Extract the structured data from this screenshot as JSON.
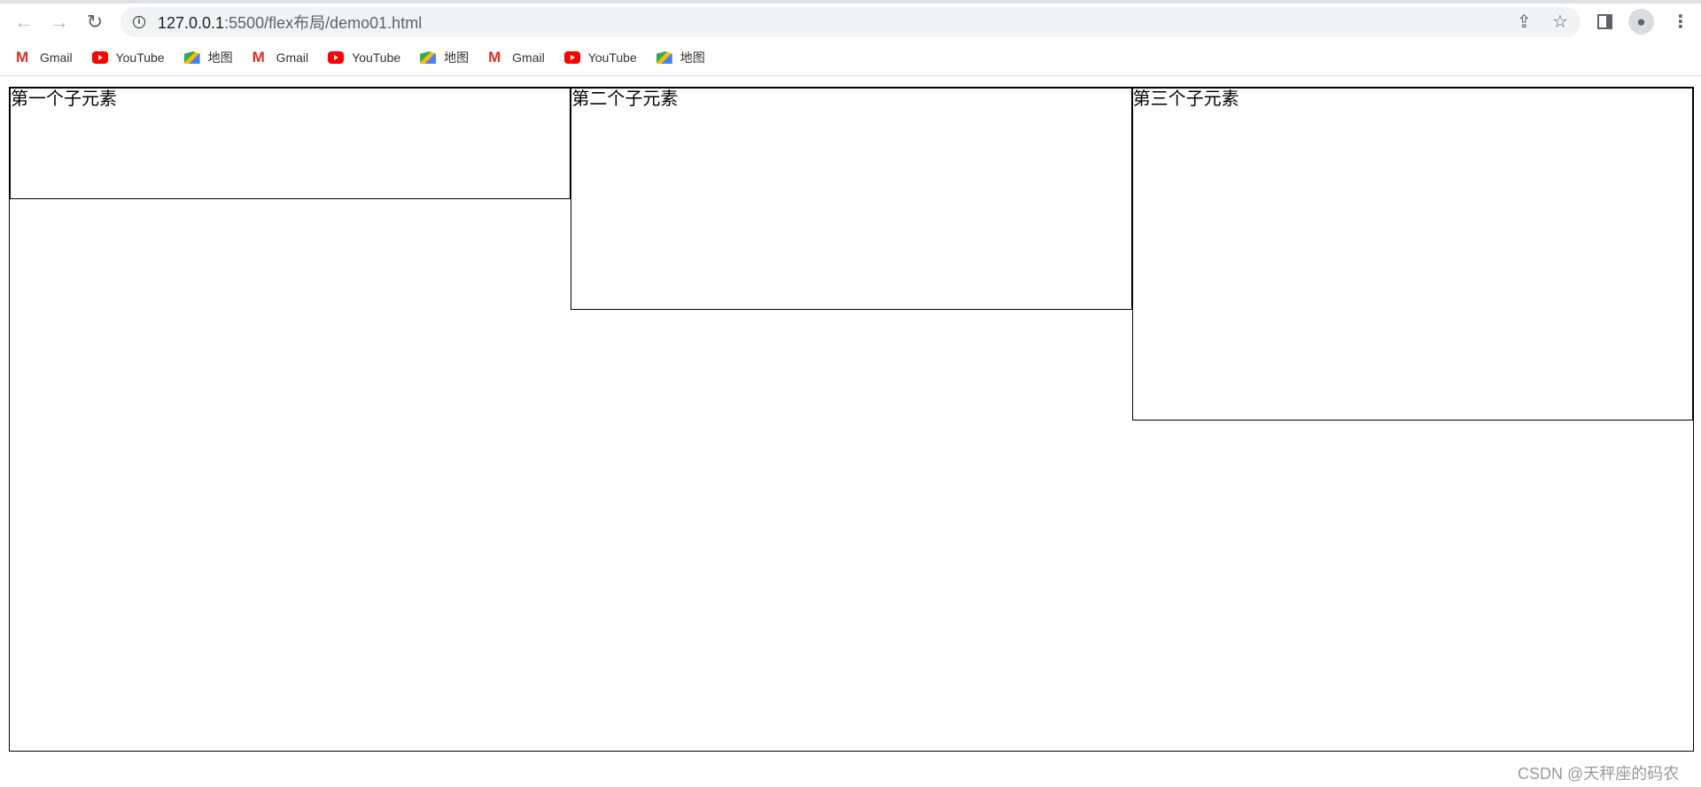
{
  "browser": {
    "url_host": "127.0.0.1",
    "url_rest": ":5500/flex布局/demo01.html",
    "bookmarks": [
      {
        "label": "Gmail",
        "icon": "gmail-icon"
      },
      {
        "label": "YouTube",
        "icon": "youtube-icon"
      },
      {
        "label": "地图",
        "icon": "maps-icon"
      },
      {
        "label": "Gmail",
        "icon": "gmail-icon"
      },
      {
        "label": "YouTube",
        "icon": "youtube-icon"
      },
      {
        "label": "地图",
        "icon": "maps-icon"
      },
      {
        "label": "Gmail",
        "icon": "gmail-icon"
      },
      {
        "label": "YouTube",
        "icon": "youtube-icon"
      },
      {
        "label": "地图",
        "icon": "maps-icon"
      }
    ]
  },
  "page": {
    "children": [
      "第一个子元素",
      "第二个子元素",
      "第三个子元素"
    ]
  },
  "watermark": "CSDN @天秤座的码农"
}
